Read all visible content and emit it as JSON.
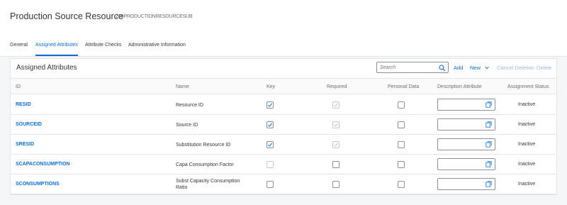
{
  "header": {
    "title": "Production Source Resource",
    "subtitle": "Z99PRODUCTIONRESOURCESUB"
  },
  "tabs": [
    {
      "label": "General",
      "active": false
    },
    {
      "label": "Assigned Attributes",
      "active": true
    },
    {
      "label": "Attribute Checks",
      "active": false
    },
    {
      "label": "Administrative Information",
      "active": false
    }
  ],
  "table": {
    "title": "Assigned Attributes",
    "search_placeholder": "Search",
    "actions": {
      "add": "Add",
      "new": "New",
      "cancel_deletion": "Cancel Deletion",
      "delete": "Delete"
    },
    "columns": [
      "ID",
      "Name",
      "Key",
      "Required",
      "Personal Data",
      "Description Attribute",
      "Assignment Status"
    ],
    "rows": [
      {
        "id": "RESID",
        "name": "Resource ID",
        "key": true,
        "required": true,
        "required_enabled": false,
        "key_enabled": true,
        "personal_data": false,
        "status": "Inactive"
      },
      {
        "id": "SOURCEID",
        "name": "Source ID",
        "key": true,
        "required": true,
        "required_enabled": false,
        "key_enabled": true,
        "personal_data": false,
        "status": "Inactive"
      },
      {
        "id": "SRESID",
        "name": "Substitution Resource ID",
        "key": true,
        "required": true,
        "required_enabled": false,
        "key_enabled": true,
        "personal_data": false,
        "status": "Inactive"
      },
      {
        "id": "SCAPACONSUMPTION",
        "name": "Capa Consumption Factor",
        "key": false,
        "required": false,
        "required_enabled": true,
        "key_enabled": false,
        "personal_data": false,
        "status": "Inactive"
      },
      {
        "id": "SCONSUMPTIONS",
        "name": "Subst Capacity Consumption Ratio",
        "key": false,
        "required": false,
        "required_enabled": true,
        "key_enabled": true,
        "personal_data": false,
        "status": "Inactive"
      }
    ]
  },
  "icons": {
    "search": "search-icon",
    "chevron": "chevron-down-icon",
    "value_help": "value-help-icon",
    "checkmark": "checkmark-icon"
  },
  "colors": {
    "accent": "#0a6ed1",
    "disabled_action": "#9fb7d8"
  }
}
